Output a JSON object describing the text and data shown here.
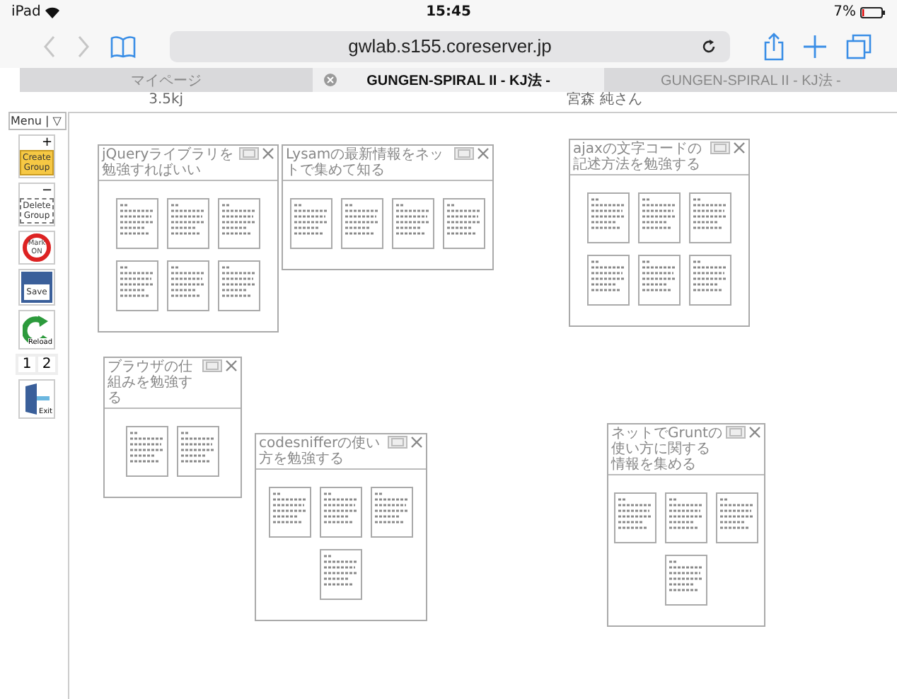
{
  "status_bar": {
    "device": "iPad",
    "time": "15:45",
    "battery": "7%"
  },
  "address_bar": {
    "url": "gwlab.s155.coreserver.jp"
  },
  "tabs": [
    {
      "label": "マイページ",
      "selected": false
    },
    {
      "label": "GUNGEN-SPIRAL II - KJ法 -",
      "selected": true
    },
    {
      "label": "GUNGEN-SPIRAL II - KJ法 -",
      "selected": false
    }
  ],
  "info_row": [
    "3.5kj",
    "宮森 純さん"
  ],
  "menu": {
    "label": "Menu",
    "separator": "|",
    "toggle": "▽"
  },
  "toolbar": [
    {
      "kind": "create",
      "label": "Create Group",
      "sign": "+"
    },
    {
      "kind": "delete",
      "label": "Delete Group",
      "sign": "−"
    },
    {
      "kind": "mark",
      "label": "Mark ON"
    },
    {
      "kind": "save",
      "label": "Save"
    },
    {
      "kind": "reload",
      "label": "Reload"
    },
    {
      "kind": "pages",
      "pages": [
        "1",
        "2"
      ]
    },
    {
      "kind": "exit",
      "label": "Exit"
    }
  ],
  "groups": [
    {
      "title": "jQueryライブラリを勉強すればいい",
      "cards": [
        {
          "kind": "note"
        },
        {
          "kind": "note"
        },
        {
          "kind": "note"
        },
        {
          "kind": "note"
        },
        {
          "kind": "note"
        },
        {
          "kind": "note"
        }
      ]
    },
    {
      "title": "Lysamの最新情報をネットで集めて知る",
      "cards": [
        {
          "kind": "note"
        },
        {
          "kind": "note"
        },
        {
          "kind": "note"
        },
        {
          "kind": "note"
        }
      ]
    },
    {
      "title": "ajaxの文字コードの記述方法を勉強する",
      "cards": [
        {
          "kind": "note"
        },
        {
          "kind": "note"
        },
        {
          "kind": "note"
        },
        {
          "kind": "note"
        },
        {
          "kind": "note"
        },
        {
          "kind": "note"
        }
      ]
    },
    {
      "title": "ブラウザの仕組みを勉強する",
      "cards": [
        {
          "kind": "note"
        },
        {
          "kind": "note"
        }
      ]
    },
    {
      "title": "codesnifferの使い方を勉強する",
      "cards": [
        {
          "kind": "note"
        },
        {
          "kind": "note"
        },
        {
          "kind": "note"
        },
        {
          "kind": "note"
        }
      ]
    },
    {
      "title": "ネットでGruntの使い方に関する情報を集める",
      "cards": [
        {
          "kind": "note"
        },
        {
          "kind": "note"
        },
        {
          "kind": "note"
        },
        {
          "kind": "note"
        }
      ]
    }
  ]
}
